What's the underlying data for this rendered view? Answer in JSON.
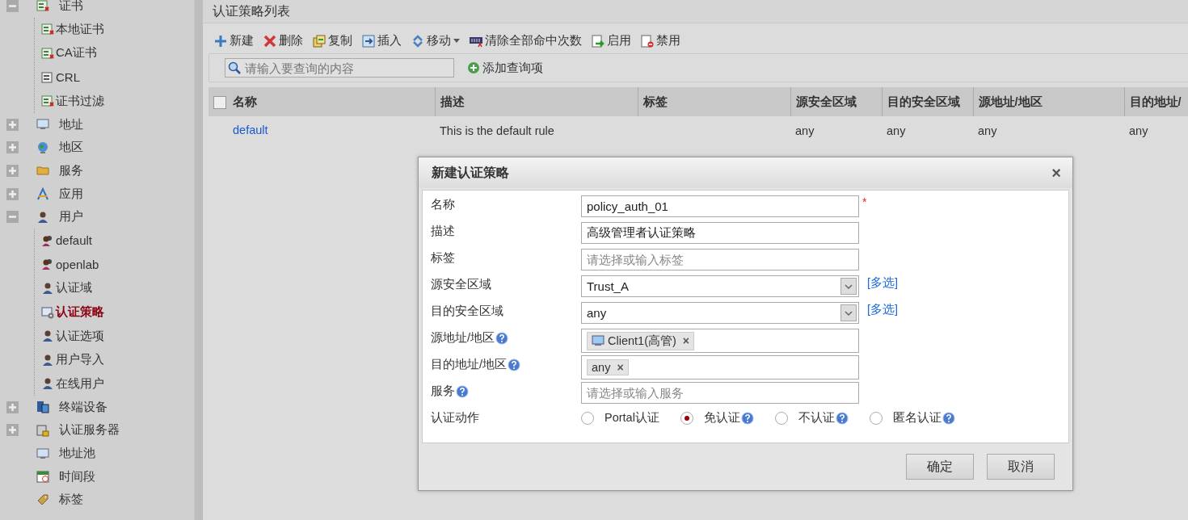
{
  "sidebar": {
    "items": [
      {
        "label": "证书",
        "kind": "group",
        "expanded": true,
        "children": [
          {
            "label": "本地证书",
            "selected": false
          },
          {
            "label": "CA证书",
            "selected": false
          },
          {
            "label": "CRL",
            "selected": false
          },
          {
            "label": "证书过滤",
            "selected": false
          }
        ]
      },
      {
        "label": "地址",
        "kind": "group",
        "expanded": false
      },
      {
        "label": "地区",
        "kind": "group",
        "expanded": false
      },
      {
        "label": "服务",
        "kind": "group",
        "expanded": false
      },
      {
        "label": "应用",
        "kind": "group",
        "expanded": false
      },
      {
        "label": "用户",
        "kind": "group",
        "expanded": true,
        "children": [
          {
            "label": "default",
            "selected": false
          },
          {
            "label": "openlab",
            "selected": false
          },
          {
            "label": "认证域",
            "selected": false
          },
          {
            "label": "认证策略",
            "selected": true
          },
          {
            "label": "认证选项",
            "selected": false
          },
          {
            "label": "用户导入",
            "selected": false
          },
          {
            "label": "在线用户",
            "selected": false
          }
        ]
      },
      {
        "label": "终端设备",
        "kind": "group",
        "expanded": false
      },
      {
        "label": "认证服务器",
        "kind": "group",
        "expanded": false
      },
      {
        "label": "地址池",
        "kind": "leaf"
      },
      {
        "label": "时间段",
        "kind": "leaf"
      },
      {
        "label": "标签",
        "kind": "leaf"
      }
    ]
  },
  "panel": {
    "title": "认证策略列表",
    "toolbar": [
      {
        "label": "新建",
        "dropdown": false
      },
      {
        "label": "删除",
        "dropdown": false
      },
      {
        "label": "复制",
        "dropdown": false
      },
      {
        "label": "插入",
        "dropdown": false
      },
      {
        "label": "移动",
        "dropdown": true
      },
      {
        "label": "清除全部命中次数",
        "dropdown": false
      },
      {
        "label": "启用",
        "dropdown": false
      },
      {
        "label": "禁用",
        "dropdown": false
      }
    ],
    "search": {
      "placeholder": "请输入要查询的内容"
    },
    "add_filter": "添加查询项",
    "table": {
      "select_all_checked": false,
      "columns": [
        "名称",
        "描述",
        "标签",
        "源安全区域",
        "目的安全区域",
        "源地址/地区",
        "目的地址/"
      ],
      "rows": [
        {
          "cells": [
            "default",
            "This is the default rule",
            "",
            "any",
            "any",
            "any",
            "any"
          ]
        }
      ]
    }
  },
  "dialog": {
    "title": "新建认证策略",
    "close": "×",
    "fields": [
      {
        "label": "名称",
        "kind": "text",
        "value": "policy_auth_01",
        "required_mark": "*",
        "help": false
      },
      {
        "label": "描述",
        "kind": "text",
        "value": "高级管理者认证策略",
        "help": false
      },
      {
        "label": "标签",
        "kind": "text",
        "placeholder": "请选择或输入标签",
        "help": false
      },
      {
        "label": "源安全区域",
        "kind": "select",
        "value": "Trust_A",
        "link": "[多选]",
        "help": false
      },
      {
        "label": "目的安全区域",
        "kind": "select",
        "value": "any",
        "link": "[多选]",
        "help": false
      },
      {
        "label": "源地址/地区",
        "kind": "tags",
        "help": true,
        "tags": [
          {
            "label": "Client1(高管)",
            "kind": "host",
            "remove": "×"
          }
        ]
      },
      {
        "label": "目的地址/地区",
        "kind": "tags",
        "help": true,
        "tags": [
          {
            "label": "any",
            "kind": "plain",
            "remove": "×"
          }
        ]
      },
      {
        "label": "服务",
        "kind": "text",
        "help": true,
        "placeholder": "请选择或输入服务"
      },
      {
        "label": "认证动作",
        "kind": "radio",
        "help": false,
        "options": [
          {
            "label": "Portal认证",
            "selected": false,
            "help": false
          },
          {
            "label": "免认证",
            "selected": true,
            "help": true
          },
          {
            "label": "不认证",
            "selected": false,
            "help": true
          },
          {
            "label": "匿名认证",
            "selected": false,
            "help": true
          }
        ]
      }
    ],
    "buttons": [
      "确定",
      "取消"
    ]
  }
}
